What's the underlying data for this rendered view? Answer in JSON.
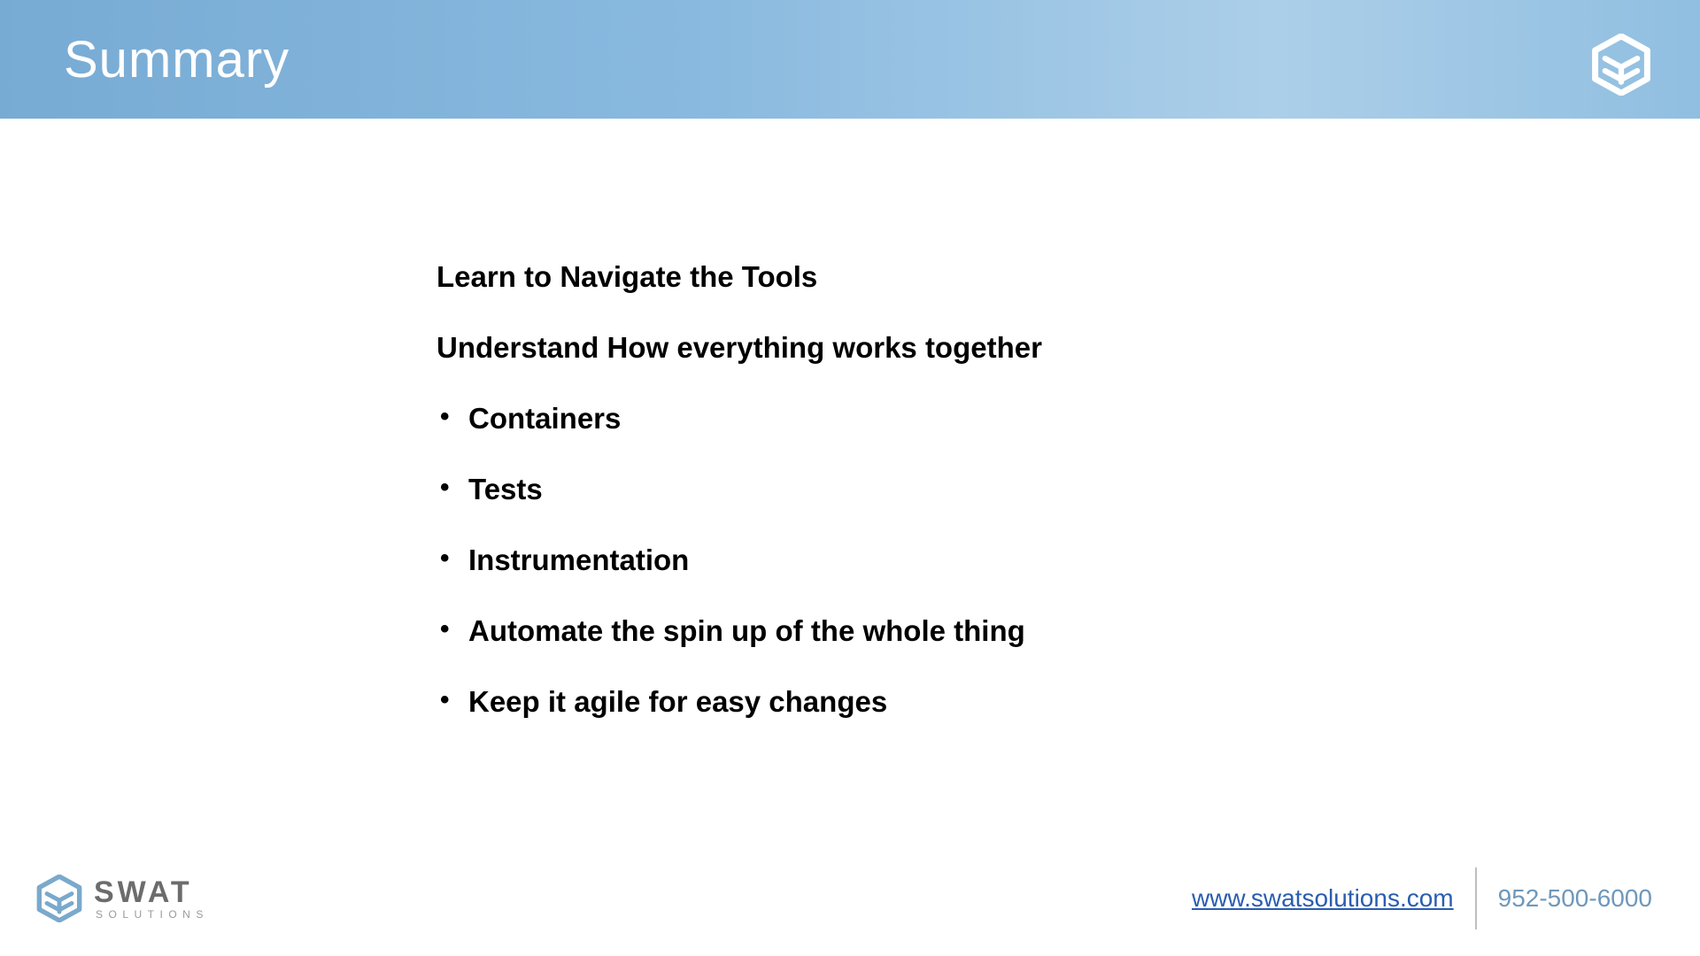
{
  "banner": {
    "title": "Summary"
  },
  "content": {
    "heading1": "Learn to Navigate the Tools",
    "heading2": "Understand How everything works together",
    "bullets": [
      "Containers",
      "Tests",
      "Instrumentation",
      "Automate the spin up of the whole thing",
      "Keep it agile for easy changes"
    ]
  },
  "footer": {
    "brand_main": "SWAT",
    "brand_sub": "SOLUTIONS",
    "site": "www.swatsolutions.com",
    "phone": "952-500-6000"
  }
}
